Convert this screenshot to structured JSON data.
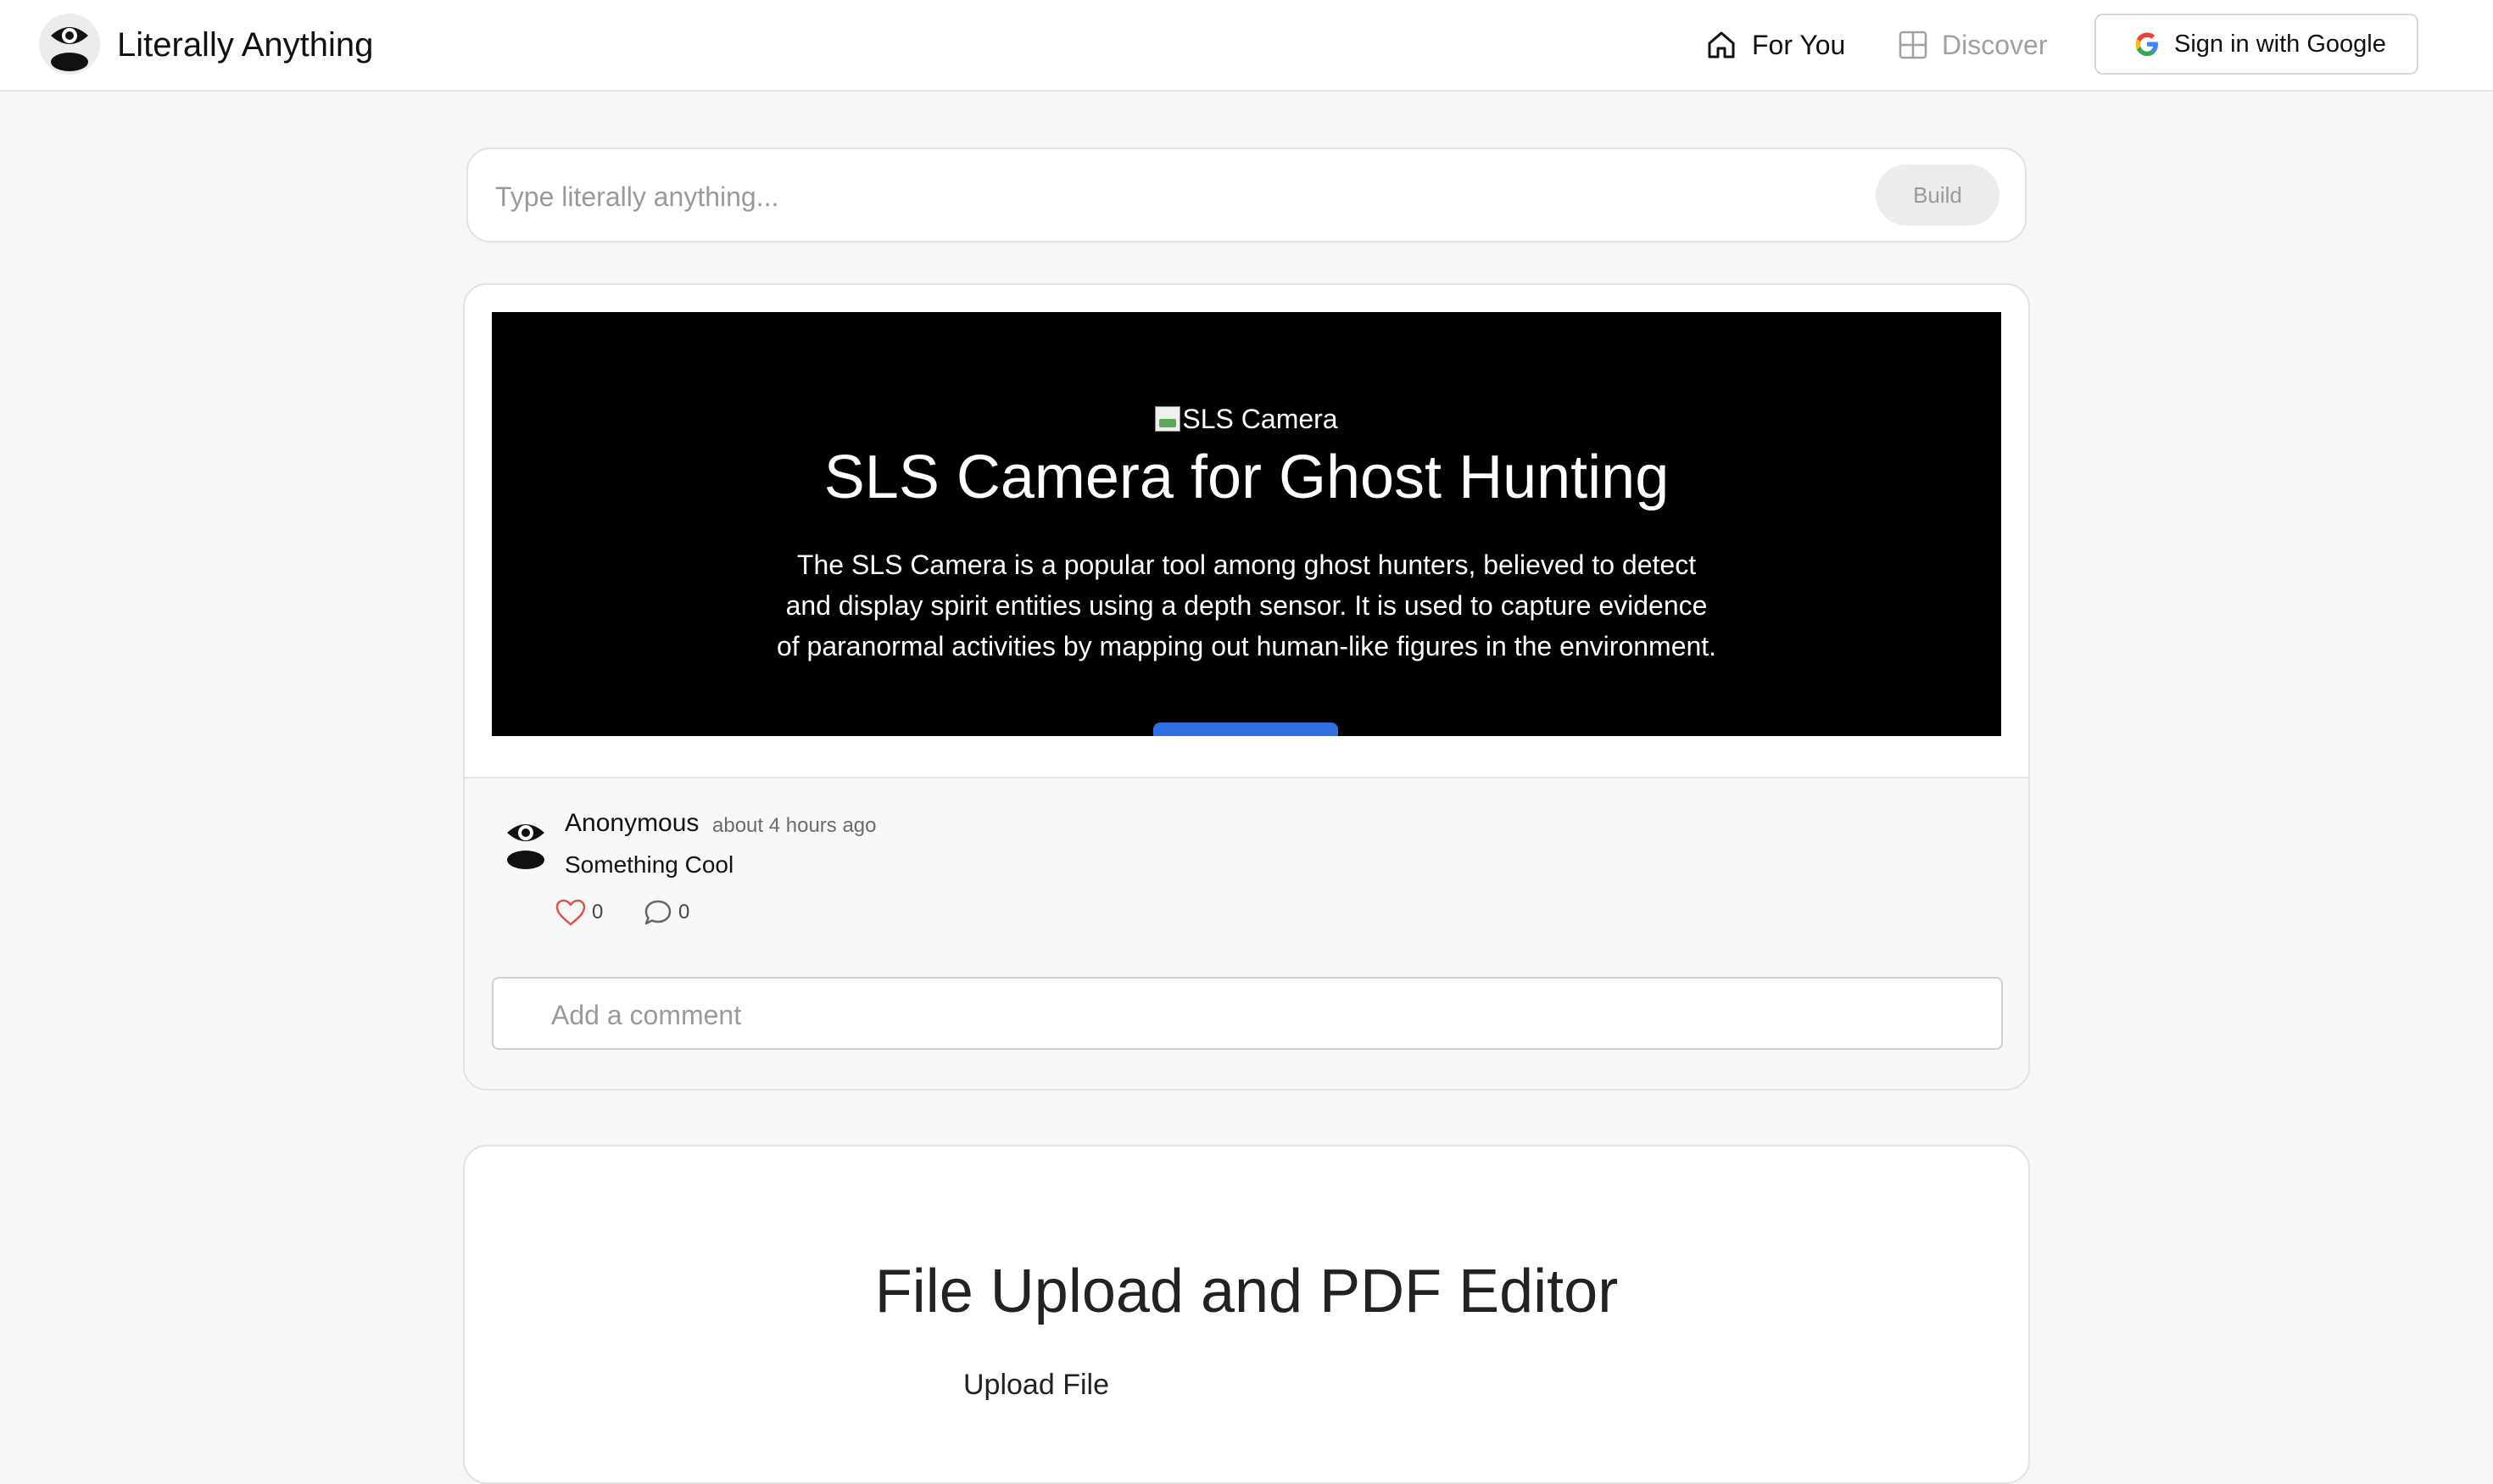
{
  "header": {
    "brand": "Literally Anything",
    "logo_icon": "eye-icon",
    "nav": [
      {
        "label": "For You",
        "icon": "home-icon",
        "active": true
      },
      {
        "label": "Discover",
        "icon": "grid-icon",
        "active": false
      }
    ],
    "signin_label": "Sign in with Google",
    "signin_icon": "google-icon"
  },
  "prompt": {
    "placeholder": "Type literally anything...",
    "value": "",
    "build_label": "Build"
  },
  "feed": [
    {
      "preview": {
        "image_alt": "SLS Camera",
        "title": "SLS Camera for Ghost Hunting",
        "description": "The SLS Camera is a popular tool among ghost hunters, believed to detect and display spirit entities using a depth sensor. It is used to capture evidence of paranormal activities by mapping out human-like figures in the environment.",
        "background": "#000000",
        "button_color": "#2f6fe0"
      },
      "post": {
        "author": "Anonymous",
        "time": "about 4 hours ago",
        "text": "Something Cool",
        "likes": "0",
        "comments": "0"
      },
      "comment_placeholder": "Add a comment"
    },
    {
      "title": "File Upload and PDF Editor",
      "subtitle": "Upload File"
    }
  ],
  "colors": {
    "accent_blue": "#2f6fe0",
    "heart": "#d9534f",
    "background": "#f7f7f7"
  }
}
